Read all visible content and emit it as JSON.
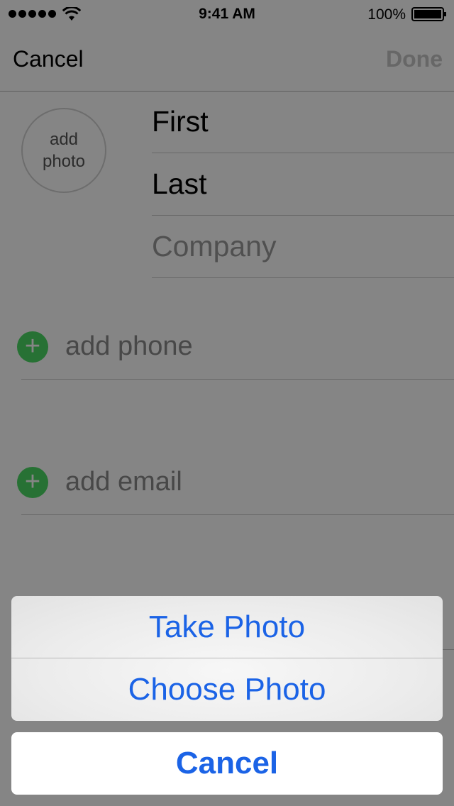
{
  "status_bar": {
    "time": "9:41 AM",
    "battery_percent": "100%",
    "signal_icon": "signal-dots-icon",
    "wifi_icon": "wifi-icon",
    "battery_icon": "battery-icon"
  },
  "nav": {
    "cancel_label": "Cancel",
    "done_label": "Done"
  },
  "photo": {
    "line1": "add",
    "line2": "photo"
  },
  "fields": {
    "first": "First",
    "last": "Last",
    "company_placeholder": "Company"
  },
  "add_rows": {
    "phone_label": "add phone",
    "email_label": "add email",
    "plus_glyph": "+"
  },
  "action_sheet": {
    "take_photo": "Take Photo",
    "choose_photo": "Choose Photo",
    "cancel": "Cancel"
  },
  "colors": {
    "accent": "#1b63e6",
    "add_green": "#4cd964",
    "dim_overlay": "rgba(0,0,0,0.48)"
  }
}
